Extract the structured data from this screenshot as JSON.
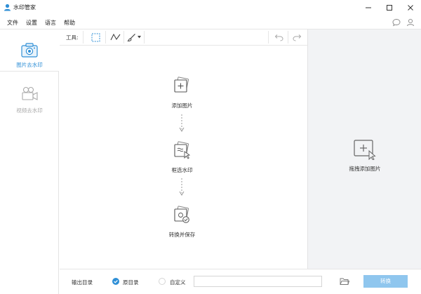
{
  "app": {
    "title": "水印管家"
  },
  "menu": {
    "items": [
      "文件",
      "设置",
      "语言",
      "帮助"
    ]
  },
  "sidebar": {
    "items": [
      {
        "label": "图片去水印",
        "icon": "camera-icon",
        "active": true
      },
      {
        "label": "视频去水印",
        "icon": "video-camera-icon",
        "active": false
      }
    ]
  },
  "toolbar": {
    "label": "工具:"
  },
  "steps": [
    {
      "label": "添加图片",
      "icon": "add-image-icon"
    },
    {
      "label": "框选水印",
      "icon": "select-watermark-icon"
    },
    {
      "label": "转换并保存",
      "icon": "convert-save-icon"
    }
  ],
  "drop": {
    "label": "拖拽添加图片"
  },
  "bottom": {
    "output_label": "输出目录",
    "option_original": "原目录",
    "option_custom": "自定义",
    "path_value": "",
    "convert_label": "转换"
  },
  "colors": {
    "accent": "#2f8fd6",
    "convert_button": "#8fc6ee",
    "drop_panel": "#f2f3f5"
  }
}
